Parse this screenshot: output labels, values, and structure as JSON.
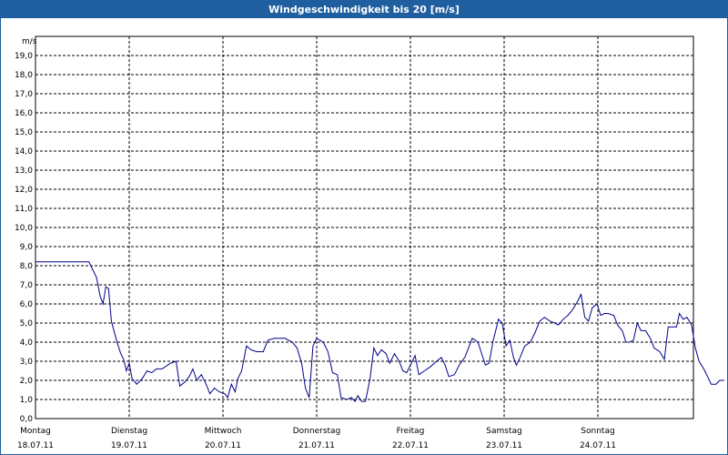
{
  "window": {
    "title": "Windgeschwindigkeit bis 20 [m/s]"
  },
  "colors": {
    "titlebar": "#1f5fa0",
    "line": "#00008b",
    "grid": "#000000"
  },
  "chart_data": {
    "type": "line",
    "title": "Windgeschwindigkeit bis 20 [m/s]",
    "ylabel": "m/s",
    "xlabel": "",
    "ylim": [
      0,
      20
    ],
    "xlim": [
      0,
      7
    ],
    "grid": true,
    "y_ticks": [
      "0,0",
      "1,0",
      "2,0",
      "3,0",
      "4,0",
      "5,0",
      "6,0",
      "7,0",
      "8,0",
      "9,0",
      "10,0",
      "11,0",
      "12,0",
      "13,0",
      "14,0",
      "15,0",
      "16,0",
      "17,0",
      "18,0",
      "19,0"
    ],
    "x_ticks": [
      {
        "day": "Montag",
        "date": "18.07.11"
      },
      {
        "day": "Dienstag",
        "date": "19.07.11"
      },
      {
        "day": "Mittwoch",
        "date": "20.07.11"
      },
      {
        "day": "Donnerstag",
        "date": "21.07.11"
      },
      {
        "day": "Freitag",
        "date": "22.07.11"
      },
      {
        "day": "Samstag",
        "date": "23.07.11"
      },
      {
        "day": "Sonntag",
        "date": "24.07.11"
      }
    ],
    "series": [
      {
        "values": [
          [
            0.0,
            8.2
          ],
          [
            0.57,
            8.2
          ],
          [
            0.6,
            7.9
          ],
          [
            0.65,
            7.4
          ],
          [
            0.69,
            6.4
          ],
          [
            0.72,
            6.0
          ],
          [
            0.75,
            6.9
          ],
          [
            0.78,
            6.8
          ],
          [
            0.81,
            5.1
          ],
          [
            0.87,
            4.0
          ],
          [
            0.91,
            3.4
          ],
          [
            0.94,
            3.1
          ],
          [
            0.97,
            2.5
          ],
          [
            1.0,
            2.9
          ],
          [
            1.03,
            2.1
          ],
          [
            1.08,
            1.8
          ],
          [
            1.14,
            2.1
          ],
          [
            1.19,
            2.5
          ],
          [
            1.24,
            2.4
          ],
          [
            1.29,
            2.6
          ],
          [
            1.35,
            2.6
          ],
          [
            1.44,
            2.9
          ],
          [
            1.5,
            3.0
          ],
          [
            1.54,
            1.7
          ],
          [
            1.59,
            1.9
          ],
          [
            1.64,
            2.2
          ],
          [
            1.68,
            2.6
          ],
          [
            1.72,
            2.0
          ],
          [
            1.77,
            2.3
          ],
          [
            1.82,
            1.8
          ],
          [
            1.86,
            1.3
          ],
          [
            1.91,
            1.6
          ],
          [
            1.96,
            1.4
          ],
          [
            2.02,
            1.3
          ],
          [
            2.05,
            1.1
          ],
          [
            2.09,
            1.8
          ],
          [
            2.13,
            1.4
          ],
          [
            2.16,
            2.1
          ],
          [
            2.2,
            2.5
          ],
          [
            2.25,
            3.8
          ],
          [
            2.3,
            3.6
          ],
          [
            2.36,
            3.5
          ],
          [
            2.43,
            3.5
          ],
          [
            2.48,
            4.1
          ],
          [
            2.55,
            4.2
          ],
          [
            2.66,
            4.2
          ],
          [
            2.74,
            4.0
          ],
          [
            2.79,
            3.7
          ],
          [
            2.84,
            2.9
          ],
          [
            2.88,
            1.6
          ],
          [
            2.92,
            1.1
          ],
          [
            2.96,
            3.8
          ],
          [
            3.0,
            4.2
          ],
          [
            3.07,
            4.0
          ],
          [
            3.12,
            3.5
          ],
          [
            3.17,
            2.4
          ],
          [
            3.22,
            2.3
          ],
          [
            3.26,
            1.1
          ],
          [
            3.32,
            1.0
          ],
          [
            3.37,
            1.1
          ],
          [
            3.41,
            0.9
          ],
          [
            3.44,
            1.2
          ],
          [
            3.48,
            0.9
          ],
          [
            3.52,
            0.9
          ],
          [
            3.57,
            2.1
          ],
          [
            3.61,
            3.7
          ],
          [
            3.65,
            3.3
          ],
          [
            3.69,
            3.6
          ],
          [
            3.74,
            3.4
          ],
          [
            3.78,
            2.9
          ],
          [
            3.83,
            3.4
          ],
          [
            3.88,
            3.0
          ],
          [
            3.92,
            2.5
          ],
          [
            3.96,
            2.4
          ],
          [
            4.0,
            2.8
          ],
          [
            4.05,
            3.3
          ],
          [
            4.09,
            2.3
          ],
          [
            4.15,
            2.5
          ],
          [
            4.21,
            2.7
          ],
          [
            4.28,
            3.0
          ],
          [
            4.33,
            3.2
          ],
          [
            4.37,
            2.8
          ],
          [
            4.41,
            2.2
          ],
          [
            4.47,
            2.3
          ],
          [
            4.52,
            2.8
          ],
          [
            4.58,
            3.2
          ],
          [
            4.66,
            4.2
          ],
          [
            4.72,
            4.0
          ],
          [
            4.76,
            3.4
          ],
          [
            4.8,
            2.8
          ],
          [
            4.84,
            2.9
          ],
          [
            4.88,
            4.0
          ],
          [
            4.94,
            5.2
          ],
          [
            4.98,
            5.0
          ],
          [
            5.02,
            3.8
          ],
          [
            5.06,
            4.1
          ],
          [
            5.1,
            3.2
          ],
          [
            5.13,
            2.8
          ],
          [
            5.17,
            3.2
          ],
          [
            5.22,
            3.8
          ],
          [
            5.28,
            4.0
          ],
          [
            5.33,
            4.5
          ],
          [
            5.38,
            5.1
          ],
          [
            5.43,
            5.3
          ],
          [
            5.49,
            5.1
          ],
          [
            5.54,
            5.0
          ],
          [
            5.58,
            4.9
          ],
          [
            5.63,
            5.2
          ],
          [
            5.68,
            5.4
          ],
          [
            5.73,
            5.7
          ],
          [
            5.78,
            6.1
          ],
          [
            5.82,
            6.5
          ],
          [
            5.86,
            5.3
          ],
          [
            5.9,
            5.1
          ],
          [
            5.94,
            5.8
          ],
          [
            5.99,
            6.0
          ],
          [
            6.03,
            5.4
          ],
          [
            6.07,
            5.5
          ],
          [
            6.11,
            5.5
          ],
          [
            6.17,
            5.4
          ],
          [
            6.21,
            4.9
          ],
          [
            6.26,
            4.6
          ],
          [
            6.3,
            4.0
          ],
          [
            6.34,
            4.0
          ],
          [
            6.38,
            4.1
          ],
          [
            6.42,
            5.0
          ],
          [
            6.46,
            4.6
          ],
          [
            6.51,
            4.6
          ],
          [
            6.56,
            4.2
          ],
          [
            6.6,
            3.7
          ],
          [
            6.66,
            3.5
          ],
          [
            6.71,
            3.1
          ],
          [
            6.75,
            4.8
          ],
          [
            6.79,
            4.8
          ],
          [
            6.84,
            4.8
          ],
          [
            6.87,
            5.5
          ],
          [
            6.91,
            5.2
          ],
          [
            6.95,
            5.3
          ],
          [
            7.0,
            4.9
          ],
          [
            7.04,
            3.7
          ],
          [
            7.08,
            3.0
          ],
          [
            7.13,
            2.6
          ],
          [
            7.17,
            2.2
          ],
          [
            7.21,
            1.8
          ],
          [
            7.26,
            1.8
          ],
          [
            7.3,
            2.0
          ],
          [
            7.35,
            2.0
          ]
        ]
      }
    ]
  }
}
